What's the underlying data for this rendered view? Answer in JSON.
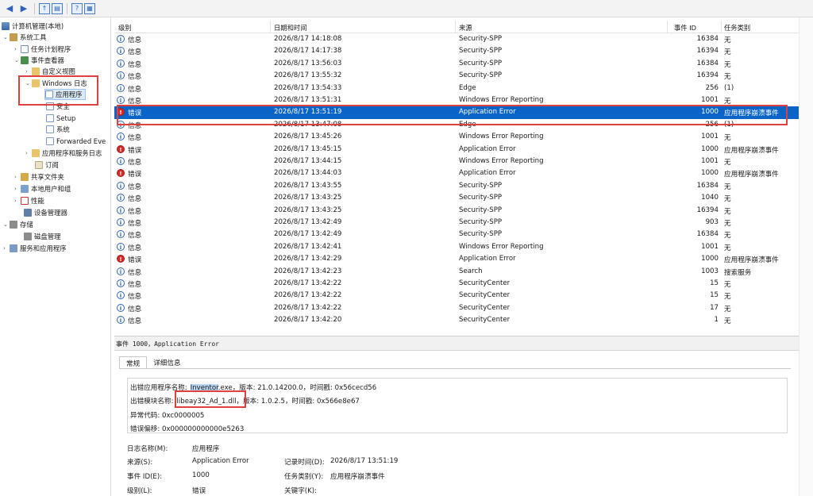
{
  "tree": {
    "root": "计算机管理(本地)",
    "system_tools": "系统工具",
    "task_scheduler": "任务计划程序",
    "event_viewer": "事件查看器",
    "custom_views": "自定义视图",
    "windows_logs": "Windows 日志",
    "application": "应用程序",
    "security": "安全",
    "setup": "Setup",
    "system": "系统",
    "forwarded": "Forwarded Eve",
    "app_service_logs": "应用程序和服务日志",
    "subscriptions": "订阅",
    "shared_folders": "共享文件夹",
    "local_users": "本地用户和组",
    "performance": "性能",
    "device_manager": "设备管理器",
    "storage": "存储",
    "disk_management": "磁盘管理",
    "services_apps": "服务和应用程序"
  },
  "columns": {
    "level": "级别",
    "datetime": "日期和时间",
    "source": "来源",
    "event_id": "事件 ID",
    "task_category": "任务类别"
  },
  "rows": [
    {
      "level": "信息",
      "type": "info",
      "datetime": "2026/8/17 14:18:08",
      "source": "Security-SPP",
      "id": "16384",
      "cat": "无"
    },
    {
      "level": "信息",
      "type": "info",
      "datetime": "2026/8/17 14:17:38",
      "source": "Security-SPP",
      "id": "16394",
      "cat": "无"
    },
    {
      "level": "信息",
      "type": "info",
      "datetime": "2026/8/17 13:56:03",
      "source": "Security-SPP",
      "id": "16384",
      "cat": "无"
    },
    {
      "level": "信息",
      "type": "info",
      "datetime": "2026/8/17 13:55:32",
      "source": "Security-SPP",
      "id": "16394",
      "cat": "无"
    },
    {
      "level": "信息",
      "type": "info",
      "datetime": "2026/8/17 13:54:33",
      "source": "Edge",
      "id": "256",
      "cat": "(1)"
    },
    {
      "level": "信息",
      "type": "info",
      "datetime": "2026/8/17 13:51:31",
      "source": "Windows Error Reporting",
      "id": "1001",
      "cat": "无"
    },
    {
      "level": "错误",
      "type": "error",
      "datetime": "2026/8/17 13:51:19",
      "source": "Application Error",
      "id": "1000",
      "cat": "应用程序崩溃事件"
    },
    {
      "level": "信息",
      "type": "info",
      "datetime": "2026/8/17 13:47:08",
      "source": "Edge",
      "id": "256",
      "cat": "(1)"
    },
    {
      "level": "信息",
      "type": "info",
      "datetime": "2026/8/17 13:45:26",
      "source": "Windows Error Reporting",
      "id": "1001",
      "cat": "无"
    },
    {
      "level": "错误",
      "type": "error",
      "datetime": "2026/8/17 13:45:15",
      "source": "Application Error",
      "id": "1000",
      "cat": "应用程序崩溃事件"
    },
    {
      "level": "信息",
      "type": "info",
      "datetime": "2026/8/17 13:44:15",
      "source": "Windows Error Reporting",
      "id": "1001",
      "cat": "无"
    },
    {
      "level": "错误",
      "type": "error",
      "datetime": "2026/8/17 13:44:03",
      "source": "Application Error",
      "id": "1000",
      "cat": "应用程序崩溃事件"
    },
    {
      "level": "信息",
      "type": "info",
      "datetime": "2026/8/17 13:43:55",
      "source": "Security-SPP",
      "id": "16384",
      "cat": "无"
    },
    {
      "level": "信息",
      "type": "info",
      "datetime": "2026/8/17 13:43:25",
      "source": "Security-SPP",
      "id": "1040",
      "cat": "无"
    },
    {
      "level": "信息",
      "type": "info",
      "datetime": "2026/8/17 13:43:25",
      "source": "Security-SPP",
      "id": "16394",
      "cat": "无"
    },
    {
      "level": "信息",
      "type": "info",
      "datetime": "2026/8/17 13:42:49",
      "source": "Security-SPP",
      "id": "903",
      "cat": "无"
    },
    {
      "level": "信息",
      "type": "info",
      "datetime": "2026/8/17 13:42:49",
      "source": "Security-SPP",
      "id": "16384",
      "cat": "无"
    },
    {
      "level": "信息",
      "type": "info",
      "datetime": "2026/8/17 13:42:41",
      "source": "Windows Error Reporting",
      "id": "1001",
      "cat": "无"
    },
    {
      "level": "错误",
      "type": "error",
      "datetime": "2026/8/17 13:42:29",
      "source": "Application Error",
      "id": "1000",
      "cat": "应用程序崩溃事件"
    },
    {
      "level": "信息",
      "type": "info",
      "datetime": "2026/8/17 13:42:23",
      "source": "Search",
      "id": "1003",
      "cat": "搜索服务"
    },
    {
      "level": "信息",
      "type": "info",
      "datetime": "2026/8/17 13:42:22",
      "source": "SecurityCenter",
      "id": "15",
      "cat": "无"
    },
    {
      "level": "信息",
      "type": "info",
      "datetime": "2026/8/17 13:42:22",
      "source": "SecurityCenter",
      "id": "15",
      "cat": "无"
    },
    {
      "level": "信息",
      "type": "info",
      "datetime": "2026/8/17 13:42:22",
      "source": "SecurityCenter",
      "id": "17",
      "cat": "无"
    },
    {
      "level": "信息",
      "type": "info",
      "datetime": "2026/8/17 13:42:20",
      "source": "SecurityCenter",
      "id": "1",
      "cat": "无"
    }
  ],
  "selected_row": 6,
  "detail": {
    "title": "事件 1000，Application Error",
    "tab_general": "常规",
    "tab_details": "详细信息",
    "line1_prefix": "出错应用程序名称:",
    "line1_app": "Inventor",
    "line1_rest": ".exe，版本: 21.0.14200.0，时间戳: 0x56cecd56",
    "line2_prefix": "出错模块名称:",
    "line2_module": "libeay32_Ad_1.dll",
    "line2_rest": "，版本: 1.0.2.5，时间戳: 0x566e8e67",
    "line3": "异常代码: 0xc0000005",
    "line4": "错误偏移: 0x000000000000e5263",
    "log_name_label": "日志名称(M):",
    "log_name_value": "应用程序",
    "source_label": "来源(S):",
    "source_value": "Application Error",
    "logged_label": "记录时间(D):",
    "logged_value": "2026/8/17 13:51:19",
    "event_id_label": "事件 ID(E):",
    "event_id_value": "1000",
    "task_label": "任务类别(Y):",
    "task_value": "应用程序崩溃事件",
    "level_label": "级别(L):",
    "level_value": "错误",
    "keywords_label": "关键字(K):"
  },
  "colors": {
    "selection": "#0a64c8",
    "annotation": "#e0413f",
    "error_icon": "#d42a2a",
    "info_icon": "#2d62b8"
  }
}
